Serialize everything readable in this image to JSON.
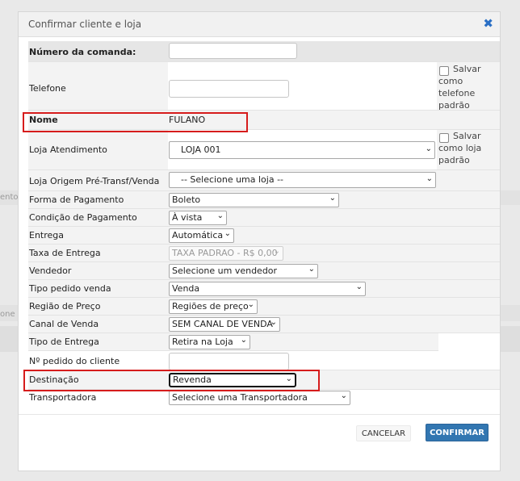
{
  "background": {
    "text_left_1": "ento",
    "text_left_2": "one"
  },
  "modal": {
    "title": "Confirmar cliente e loja",
    "close_icon": "close-icon",
    "accent_color": "#3276b1"
  },
  "form": {
    "numero_comanda": {
      "label": "Número da comanda:",
      "value": ""
    },
    "telefone": {
      "label": "Telefone",
      "value": "",
      "checkbox_label": "Salvar como telefone padrão",
      "checked": false
    },
    "nome": {
      "label": "Nome",
      "value": "FULANO"
    },
    "loja_atendimento": {
      "label": "Loja Atendimento",
      "value": "LOJA 001",
      "checkbox_label": "Salvar como loja padrão",
      "checked": false
    },
    "loja_origem": {
      "label": "Loja Origem Pré-Transf/Venda",
      "value": "-- Selecione uma loja --"
    },
    "forma_pagamento": {
      "label": "Forma de Pagamento",
      "value": "Boleto"
    },
    "condicao_pagamento": {
      "label": "Condição de Pagamento",
      "value": "À vista"
    },
    "entrega": {
      "label": "Entrega",
      "value": "Automática"
    },
    "taxa_entrega": {
      "label": "Taxa de Entrega",
      "value": "TAXA PADRAO - R$ 0,00"
    },
    "vendedor": {
      "label": "Vendedor",
      "value": "Selecione um vendedor"
    },
    "tipo_pedido": {
      "label": "Tipo pedido venda",
      "value": "Venda"
    },
    "regiao_preco": {
      "label": "Região de Preço",
      "value": "Regiões de preço"
    },
    "canal_venda": {
      "label": "Canal de Venda",
      "value": "SEM CANAL DE VENDA"
    },
    "tipo_entrega": {
      "label": "Tipo de Entrega",
      "value": "Retira na Loja"
    },
    "pedido_cliente": {
      "label": "Nº pedido do cliente",
      "value": ""
    },
    "destinacao": {
      "label": "Destinação",
      "value": "Revenda"
    },
    "transportadora": {
      "label": "Transportadora",
      "value": "Selecione uma Transportadora"
    }
  },
  "buttons": {
    "cancel": "CANCELAR",
    "confirm": "CONFIRMAR"
  },
  "highlight_color": "#d61c1c"
}
